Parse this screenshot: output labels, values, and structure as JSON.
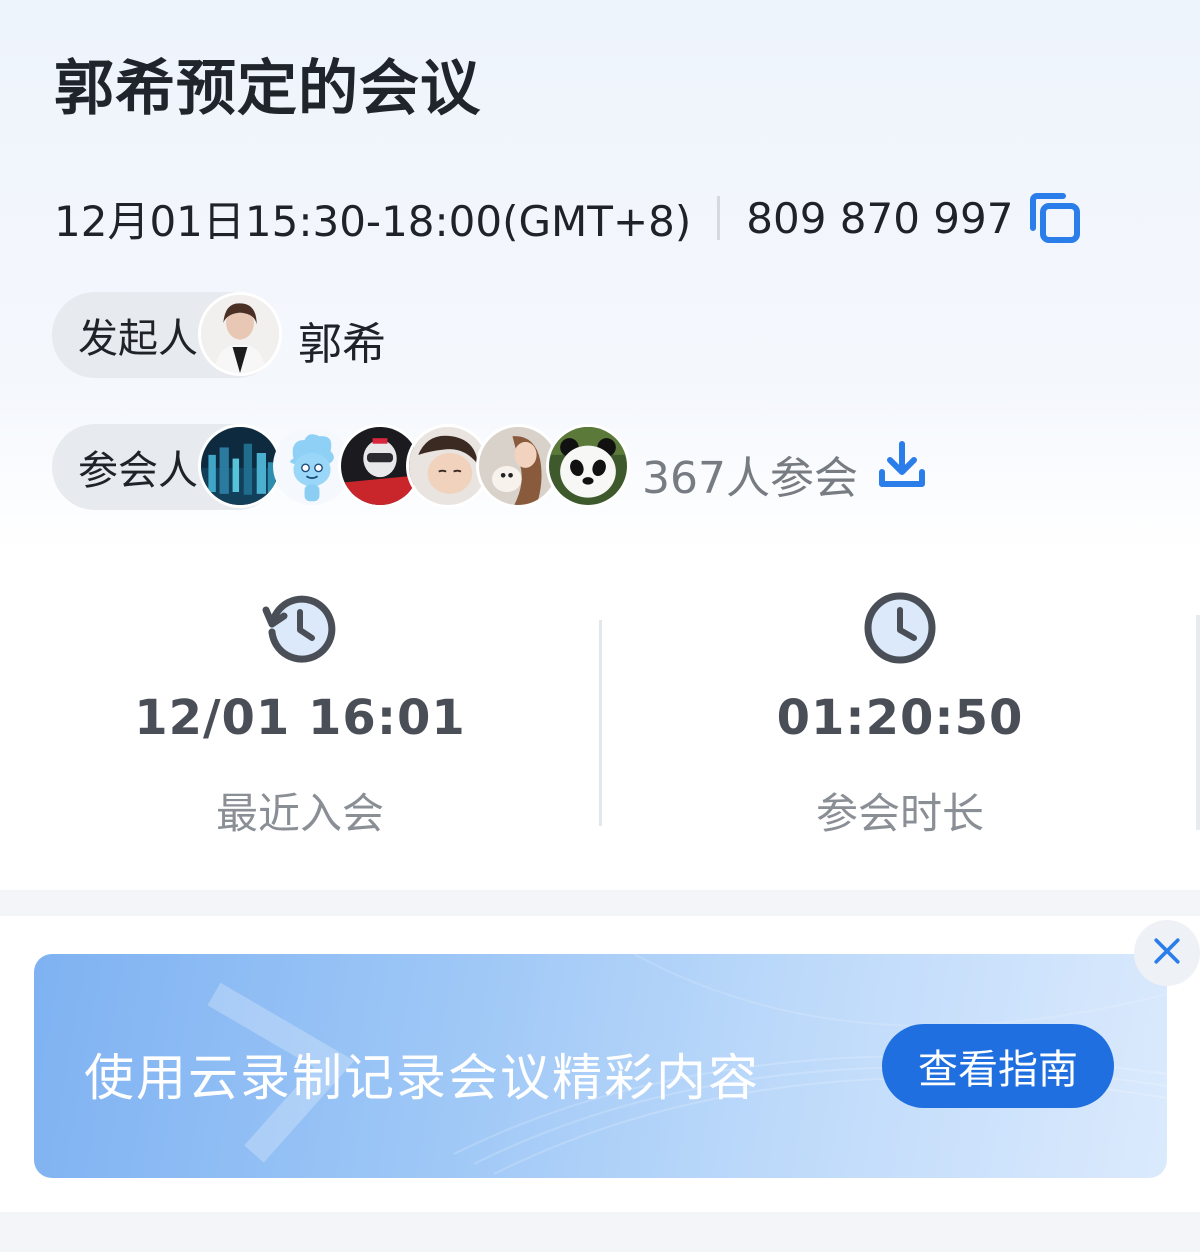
{
  "header": {
    "title": "郭希预定的会议"
  },
  "meeting": {
    "time": "12月01日15:30-18:00(GMT+8)",
    "meeting_id": "809 870 997",
    "copy_icon": "copy-icon"
  },
  "organizer": {
    "label": "发起人",
    "name": "郭希"
  },
  "participants": {
    "label": "参会人",
    "count_text": "367人参会",
    "download_icon": "download-icon"
  },
  "stats": {
    "recent_join": {
      "icon": "history-clock-icon",
      "value": "12/01 16:01",
      "label": "最近入会"
    },
    "duration": {
      "icon": "clock-icon",
      "value": "01:20:50",
      "label": "参会时长"
    }
  },
  "banner": {
    "text": "使用云录制记录会议精彩内容",
    "button_label": "查看指南",
    "close_icon": "close-icon"
  },
  "colors": {
    "accent": "#1f6fe0",
    "icon_blue": "#2b7de9"
  }
}
